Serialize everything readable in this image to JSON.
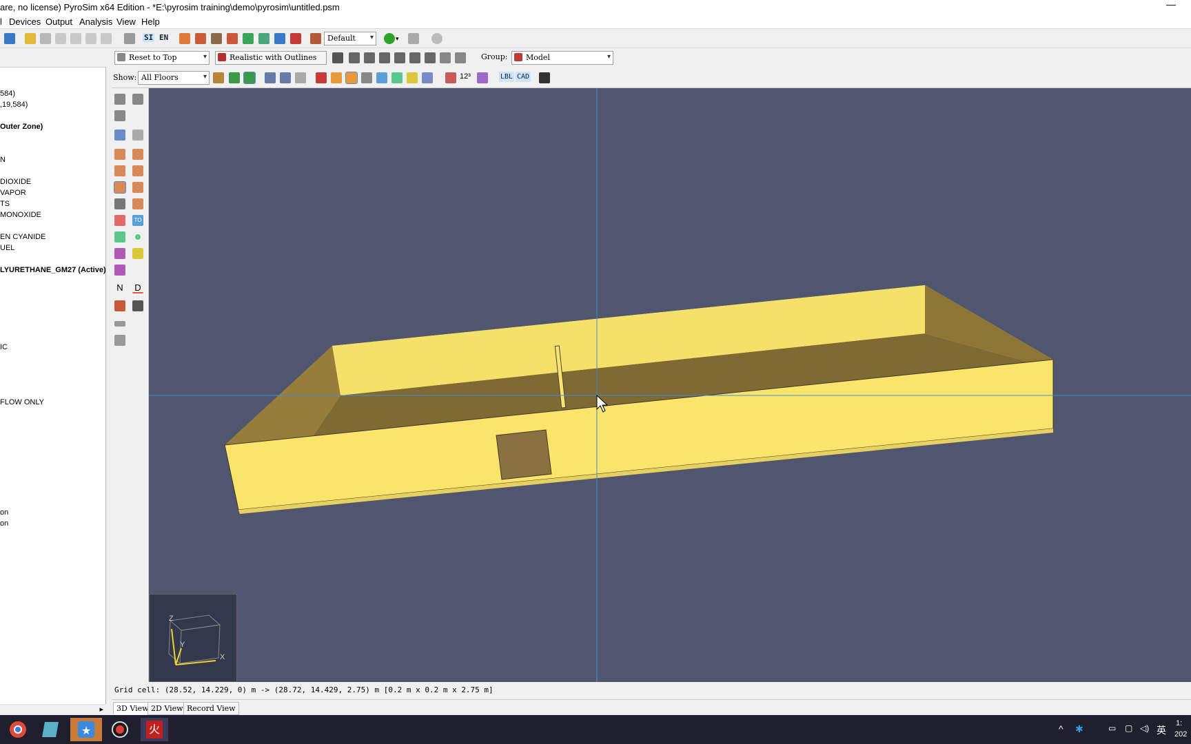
{
  "window": {
    "title": "are, no license) PyroSim x64 Edition - *E:\\pyrosim training\\demo\\pyrosim\\untitled.psm",
    "minimize_glyph": "—"
  },
  "menu": [
    "l",
    "Devices",
    "Output",
    "Analysis",
    "View",
    "Help"
  ],
  "toolbar": {
    "units_si": "SI",
    "units_en": "EN",
    "view_preset": "Default"
  },
  "view_toolbar": {
    "reset_view": "Reset to Top",
    "render_mode": "Realistic with Outlines",
    "group_label": "Group:",
    "group_value": "Model",
    "show_label": "Show:",
    "show_value": "All Floors",
    "digits_label": "12³",
    "lbl_button": "LBL",
    "cad_button": "CAD"
  },
  "side_tools": {
    "n_button": "N",
    "d_button": "D",
    "to_button": "TO"
  },
  "tree": [
    {
      "text": "584)",
      "bold": false
    },
    {
      "text": ",19,584)",
      "bold": false
    },
    {
      "text": "Outer Zone)",
      "bold": true
    },
    {
      "text": "N",
      "bold": false
    },
    {
      "text": " DIOXIDE",
      "bold": false
    },
    {
      "text": "VAPOR",
      "bold": false
    },
    {
      "text": "TS",
      "bold": false
    },
    {
      "text": " MONOXIDE",
      "bold": false
    },
    {
      "text": "EN CYANIDE",
      "bold": false
    },
    {
      "text": "UEL",
      "bold": false
    },
    {
      "text": "LYURETHANE_GM27 (Active)",
      "bold": true
    },
    {
      "text": "IC",
      "bold": false
    },
    {
      "text": " FLOW ONLY",
      "bold": false
    },
    {
      "text": "on",
      "bold": false
    },
    {
      "text": "on",
      "bold": false
    }
  ],
  "status": {
    "grid_cell": "Grid cell: (28.52, 14.229, 0) m -> (28.72, 14.429, 2.75) m [0.2 m x 0.2 m x 2.75 m]"
  },
  "view_tabs": [
    "3D View",
    "2D View",
    "Record View"
  ],
  "axes": {
    "z": "Z",
    "y": "Y",
    "x": "X"
  },
  "taskbar": {
    "apps": [
      "chrome-icon",
      "app-icon",
      "star-app-icon",
      "record-icon",
      "pyrosim-icon"
    ],
    "pyrosim_glyph": "火",
    "ime": "英",
    "clock_time": "1:",
    "clock_date": "202"
  },
  "colors": {
    "viewport_bg": "#4f566d",
    "model_yellow": "#fbe36b",
    "crosshair": "#3a8fe0"
  }
}
